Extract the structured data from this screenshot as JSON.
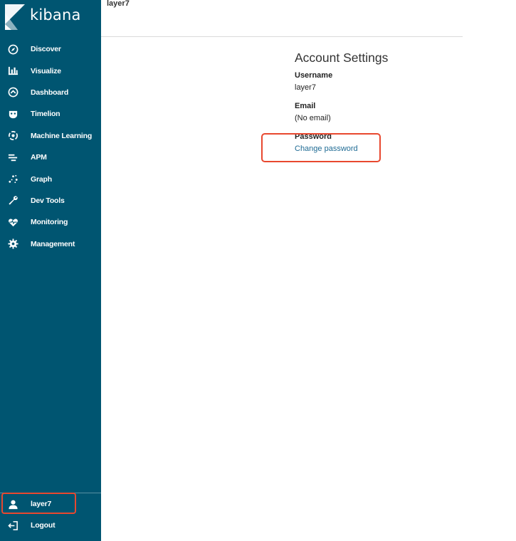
{
  "brand": {
    "name": "kibana"
  },
  "topbar": {
    "title": "layer7"
  },
  "nav": {
    "items": [
      {
        "label": "Discover",
        "icon": "compass-icon"
      },
      {
        "label": "Visualize",
        "icon": "bar-chart-icon"
      },
      {
        "label": "Dashboard",
        "icon": "dashboard-gauge-icon"
      },
      {
        "label": "Timelion",
        "icon": "timelion-mask-icon"
      },
      {
        "label": "Machine Learning",
        "icon": "machine-learning-icon"
      },
      {
        "label": "APM",
        "icon": "apm-icon"
      },
      {
        "label": "Graph",
        "icon": "graph-icon"
      },
      {
        "label": "Dev Tools",
        "icon": "wrench-icon"
      },
      {
        "label": "Monitoring",
        "icon": "heartbeat-icon"
      },
      {
        "label": "Management",
        "icon": "gear-icon"
      }
    ]
  },
  "sidebar_bottom": {
    "user_label": "layer7",
    "logout_label": "Logout"
  },
  "account": {
    "title": "Account Settings",
    "username_label": "Username",
    "username_value": "layer7",
    "email_label": "Email",
    "email_value": "(No email)",
    "password_label": "Password",
    "change_password_link": "Change password"
  },
  "colors": {
    "sidebar_bg": "#005571",
    "link": "#1f6b94",
    "highlight": "#e8482f"
  }
}
